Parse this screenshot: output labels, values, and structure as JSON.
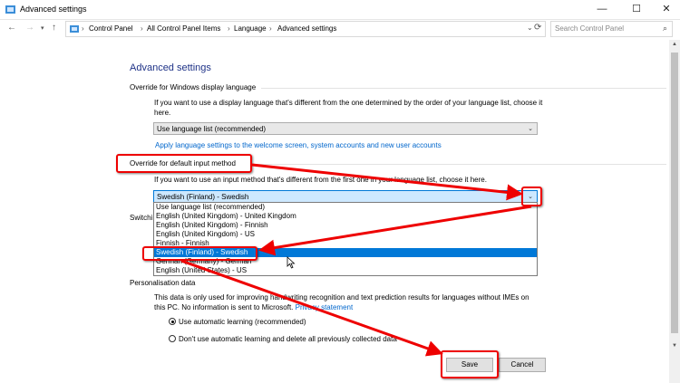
{
  "window": {
    "title": "Advanced settings",
    "minimize": "—",
    "maximize": "☐",
    "close": "✕"
  },
  "address": {
    "crumbs": [
      "Control Panel",
      "All Control Panel Items",
      "Language",
      "Advanced settings"
    ],
    "search_placeholder": "Search Control Panel"
  },
  "page": {
    "title": "Advanced settings"
  },
  "display_language": {
    "header": "Override for Windows display language",
    "desc": "If you want to use a display language that's different from the one determined by the order of your language list, choose it here.",
    "selected": "Use language list (recommended)",
    "link": "Apply language settings to the welcome screen, system accounts and new user accounts"
  },
  "input_method": {
    "header": "Override for default input method",
    "desc": "If you want to use an input method that's different from the first one in your language list, choose it here.",
    "selected": "Swedish (Finland) - Swedish",
    "options": [
      "Use language list (recommended)",
      "English (United Kingdom) - United Kingdom",
      "English (United Kingdom) - Finnish",
      "English (United Kingdom) - US",
      "Finnish - Finnish",
      "Swedish (Finland) - Swedish",
      "German (Germany) - German",
      "English (United States) - US"
    ],
    "selected_index": 5
  },
  "switching": {
    "header_partial": "Switchi"
  },
  "personalisation": {
    "header": "Personalisation data",
    "desc": "This data is only used for improving handwriting recognition and text prediction results for languages without IMEs on this PC. No information is sent to Microsoft.",
    "privacy_link": "Privacy statement",
    "option_auto": "Use automatic learning (recommended)",
    "option_manual": "Don't use automatic learning and delete all previously collected data"
  },
  "buttons": {
    "save": "Save",
    "cancel": "Cancel"
  },
  "colors": {
    "accent": "#0078d7",
    "title": "#1e3287",
    "annotation": "#ee0000",
    "link": "#0066cc"
  },
  "icons": [
    "control-panel-icon",
    "back-arrow-icon",
    "forward-arrow-icon",
    "chevron-down-icon",
    "up-arrow-icon",
    "refresh-icon",
    "search-icon"
  ]
}
